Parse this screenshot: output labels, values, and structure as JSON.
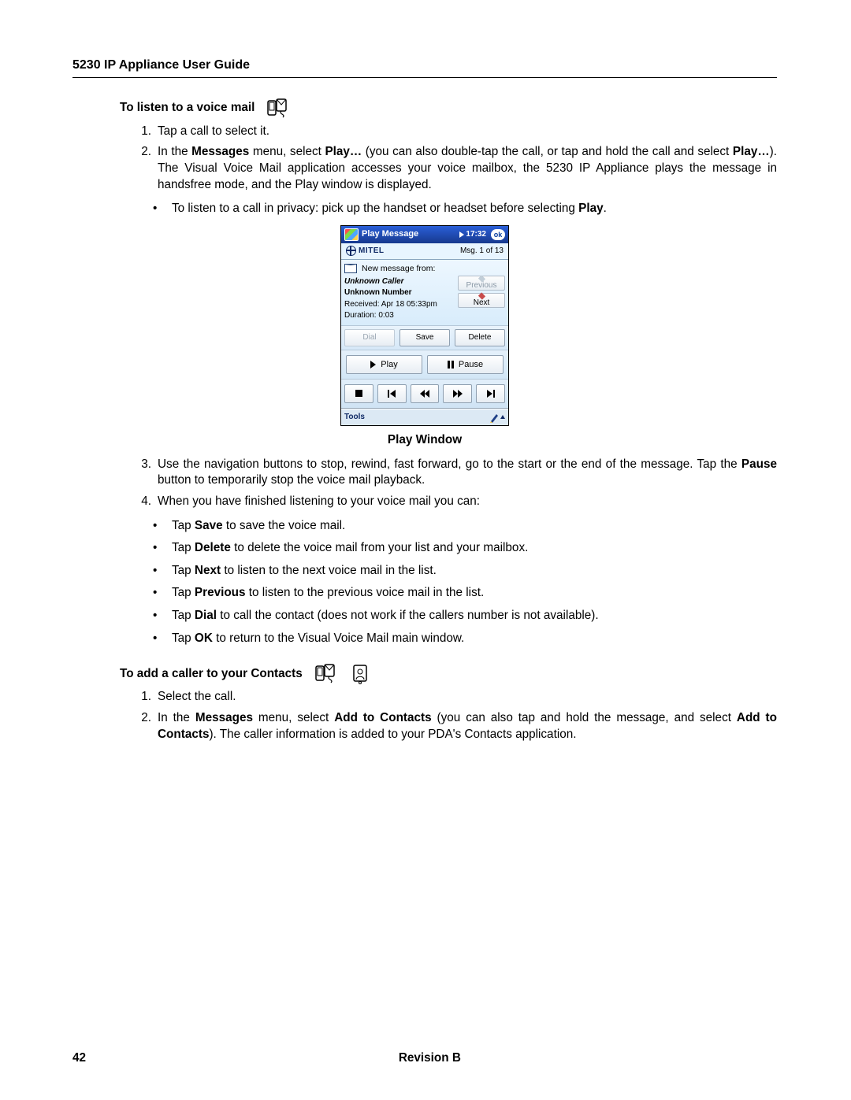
{
  "header": {
    "title": "5230 IP Appliance User Guide"
  },
  "section1": {
    "title": "To listen to a voice mail",
    "step1": "Tap a call to select it.",
    "step2_pre": "In the ",
    "step2_b1": "Messages",
    "step2_mid1": " menu, select ",
    "step2_b2": "Play…",
    "step2_mid2": " (you can also double-tap the call, or tap and hold the call and select ",
    "step2_b3": "Play…",
    "step2_tail": "). The Visual Voice Mail application accesses your voice mailbox, the 5230 IP Appliance plays the message in handsfree mode, and the Play window is displayed.",
    "sub1_pre": "To listen to a call in privacy: pick up the handset or headset before selecting ",
    "sub1_b": "Play",
    "sub1_end": "."
  },
  "figure": {
    "caption": "Play Window"
  },
  "section1b": {
    "step3_pre": "Use the navigation buttons to stop, rewind, fast forward, go to the start or the end of the message. Tap the ",
    "step3_b": "Pause",
    "step3_tail": " button to temporarily stop the voice mail playback.",
    "step4": "When you have finished listening to your voice mail you can:",
    "opt1_pre": "Tap ",
    "opt1_b": "Save",
    "opt1_tail": " to save the voice mail.",
    "opt2_pre": "Tap ",
    "opt2_b": "Delete",
    "opt2_tail": " to delete the voice mail from your list and your mailbox.",
    "opt3_pre": "Tap ",
    "opt3_b": "Next",
    "opt3_tail": " to listen to the next voice mail in the list.",
    "opt4_pre": "Tap ",
    "opt4_b": "Previous",
    "opt4_tail": " to listen to the previous voice mail in the list.",
    "opt5_pre": "Tap ",
    "opt5_b": "Dial",
    "opt5_tail": " to call the contact (does not work if the callers number is not available).",
    "opt6_pre": "Tap ",
    "opt6_b": "OK",
    "opt6_tail": " to return to the Visual Voice Mail main window."
  },
  "section2": {
    "title": "To add a caller to your Contacts",
    "step1": "Select the call.",
    "step2_pre": "In the ",
    "step2_b1": "Messages",
    "step2_mid1": " menu, select ",
    "step2_b2": "Add to Contacts",
    "step2_mid2": " (you can also tap and hold the message, and select ",
    "step2_b3": "Add to Contacts",
    "step2_tail": "). The caller information is added to your PDA's Contacts application."
  },
  "pda": {
    "title": "Play Message",
    "time": "17:32",
    "ok": "ok",
    "brand": "MITEL",
    "msgcount": "Msg. 1 of 13",
    "newmsg": "New message from:",
    "caller": "Unknown Caller",
    "number": "Unknown Number",
    "received": "Received: Apr 18 05:33pm",
    "duration": "Duration: 0:03",
    "prev": "Previous",
    "next": "Next",
    "dial": "Dial",
    "save": "Save",
    "delete": "Delete",
    "play": "Play",
    "pause": "Pause",
    "tools": "Tools"
  },
  "footer": {
    "page": "42",
    "rev": "Revision B"
  }
}
